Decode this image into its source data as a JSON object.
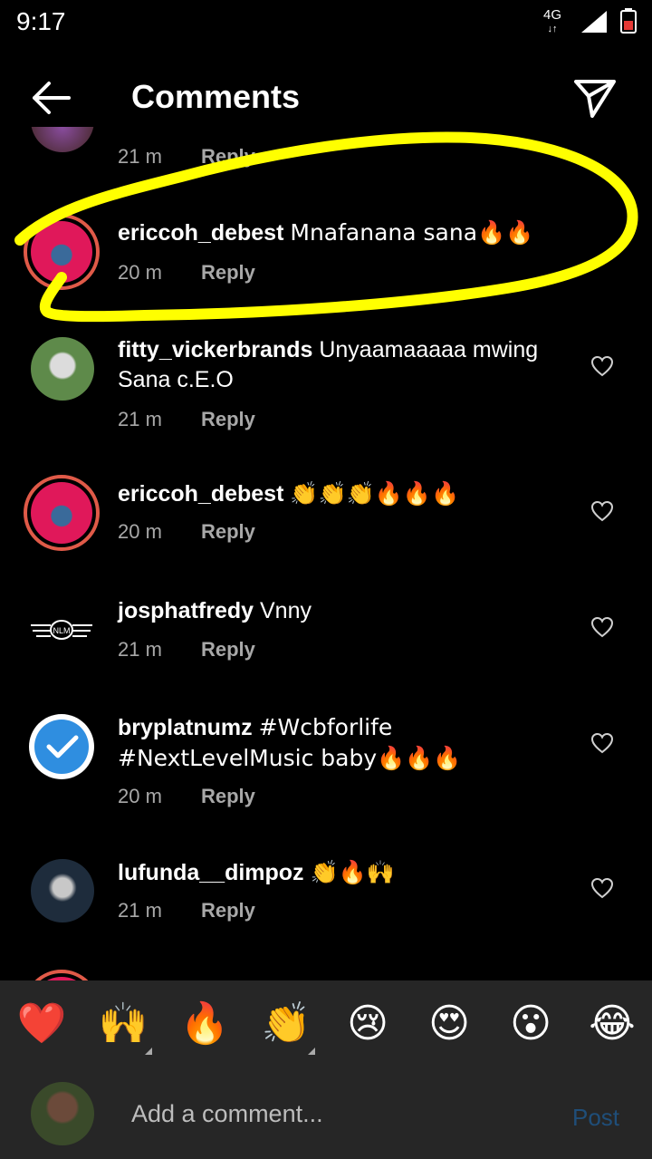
{
  "status": {
    "time": "9:17",
    "network": "4G"
  },
  "header": {
    "title": "Comments"
  },
  "partial_comment": {
    "time": "21 m",
    "reply": "Reply"
  },
  "comments": [
    {
      "user": "ericcoh_debest",
      "text": "Mnafanana sana🔥🔥",
      "time": "20 m",
      "reply": "Reply"
    },
    {
      "user": "fitty_vickerbrands",
      "text": "Unyaamaaaaa mwing Sana c.E.O",
      "time": "21 m",
      "reply": "Reply"
    },
    {
      "user": "ericcoh_debest",
      "text": "👏👏👏🔥🔥🔥",
      "time": "20 m",
      "reply": "Reply"
    },
    {
      "user": "josphatfredy",
      "text": "Vnny",
      "time": "21 m",
      "reply": "Reply"
    },
    {
      "user": "bryplatnumz",
      "text": "#Wcbforlife #NextLevelMusic baby🔥🔥🔥",
      "time": "20 m",
      "reply": "Reply"
    },
    {
      "user": "lufunda__dimpoz",
      "text": "👏🔥🙌",
      "time": "21 m",
      "reply": "Reply"
    }
  ],
  "reactions": [
    "❤️",
    "🙌",
    "🔥",
    "👏",
    "😢",
    "😍",
    "😮",
    "😂"
  ],
  "composer": {
    "placeholder": "Add a comment...",
    "post_label": "Post"
  },
  "colors": {
    "highlight": "#ffff00",
    "ring": "#e05a48",
    "post": "#1f4e79",
    "bar": "#262626"
  }
}
